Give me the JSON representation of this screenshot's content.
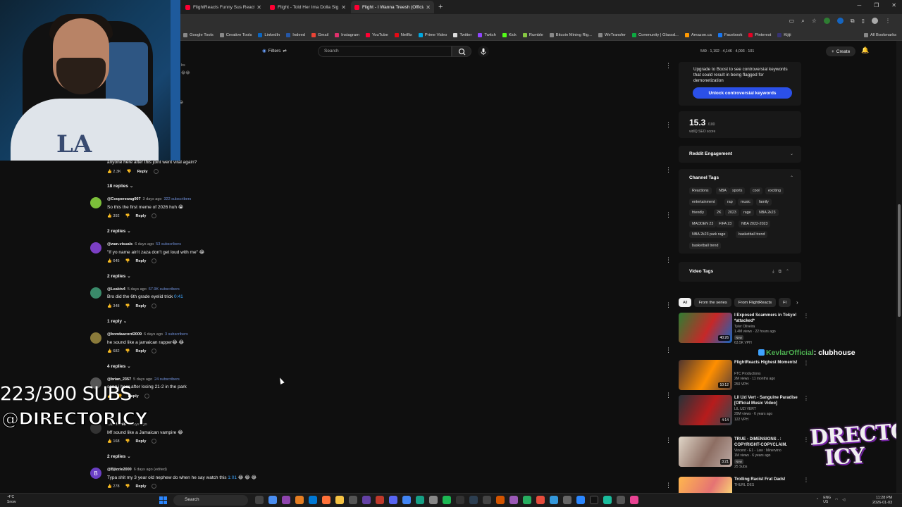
{
  "browser": {
    "tabs": [
      {
        "label": "FlightReacts Funny Sus Reactio",
        "active": false
      },
      {
        "label": "Flight - Told Her Ima Dolla Sig",
        "active": false
      },
      {
        "label": "Flight - I Wanna Treesh (Officia",
        "active": true
      }
    ],
    "bookmarks": [
      "Google Tools",
      "Creative Tools",
      "LinkedIn",
      "Indeed",
      "Gmail",
      "Instagram",
      "YouTube",
      "Netflix",
      "Prime Video",
      "Twitter",
      "Twitch",
      "Kick",
      "Rumble",
      "Bitcoin Mining Rig...",
      "WeTransfer",
      "Community | Glassd...",
      "Amazon.ca",
      "Facebook",
      "Pinterest",
      "Kijiji"
    ],
    "all_bookmarks": "All Bookmarks"
  },
  "masthead": {
    "filters_label": "Filters",
    "search_placeholder": "Search",
    "stats": "549 · 1,192 · 4,146 · 4,093 · 101",
    "create_label": "Create"
  },
  "comments": {
    "pinned_text": "anyone here after this joint went viral again?",
    "pinned_likes": "2.3K",
    "pinned_replies": "18 replies",
    "items": [
      {
        "user": "@Cooperswag007",
        "time": "3 days ago",
        "subs": "322 subscribers",
        "text": "So this the first meme of 2026 huh 😭",
        "likes": "392",
        "replies": "2 replies",
        "avatar_color": "#7cbf3a",
        "avatar_letter": ""
      },
      {
        "user": "@wan.visuals",
        "time": "6 days ago",
        "subs": "53 subscribers",
        "text": "\"If yo name ain't zaza don't get loud with me\" 😂",
        "likes": "645",
        "replies": "2 replies",
        "avatar_color": "#7b3fc4",
        "avatar_letter": ""
      },
      {
        "user": "@Leaktv4",
        "time": "5 days ago",
        "subs": "67.9K subscribers",
        "text": "Bro did the 6th grade eyelid trick",
        "timestamp": "0:41",
        "likes": "348",
        "replies": "1 reply",
        "avatar_color": "#3a8a6a",
        "avatar_letter": ""
      },
      {
        "user": "@bondaacord2009",
        "time": "6 days ago",
        "subs": "3 subscribers",
        "text": "he sound like a jamaican rapper😂 😂",
        "likes": "682",
        "replies": "4 replies",
        "avatar_color": "#8a7a3a",
        "avatar_letter": ""
      },
      {
        "user": "@brian_2357",
        "time": "5 days ago",
        "subs": "24 subscribers",
        "text": "song i hear after losing 21-2 in the park",
        "likes": "",
        "replies": "",
        "avatar_color": "#555555",
        "avatar_letter": ""
      },
      {
        "user": "...iz-demi8",
        "time": "6 days ago",
        "subs": "",
        "text": "Mf sound like a Jamaican vampire 😂",
        "likes": "168",
        "replies": "2 replies",
        "avatar_color": "#333333",
        "avatar_letter": ""
      },
      {
        "user": "@Bjizzle2000",
        "time": "6 days ago (edited)",
        "subs": "",
        "text": "Typa shit my 3 year old nephew do when he say watch this",
        "timestamp": "1:01",
        "text_suffix": "😂 😂 😂",
        "likes": "278",
        "replies": "",
        "avatar_color": "#6a3fc4",
        "avatar_letter": "B"
      }
    ],
    "reply_label": "Reply"
  },
  "overlays": {
    "subs_count": "223/300 SUBS",
    "handle": "@DIRECTORICY",
    "brand_logo": "DIRECTOR ICY",
    "chat_user": "KevlarOfficial",
    "chat_message": ": clubhouse"
  },
  "vidiq": {
    "upgrade_text": "Upgrade to Boost to see controversial keywords that could result in being flagged for demonetization",
    "unlock_label": "Unlock controversial keywords",
    "seo_score": "15.3",
    "seo_max": "/100",
    "seo_label": "vidIQ SEO score",
    "reddit_label": "Reddit Engagement",
    "channel_tags_label": "Channel Tags",
    "channel_tags": [
      "Reactions",
      "NBA",
      "sports",
      "cool",
      "exciting",
      "entertainment",
      "rap",
      "music",
      "family",
      "friendly",
      "2K",
      "2023",
      "rage",
      "NBA 2k23",
      "MADDEN 23",
      "FIFA 23",
      "NBA 2022-2023",
      "NBA 2k23 park rage",
      "basketball trend",
      "basketball trend"
    ],
    "video_tags_label": "Video Tags"
  },
  "related": {
    "chips": [
      "All",
      "From the series",
      "From FlightReacts",
      "Fl"
    ],
    "items": [
      {
        "title": "I Exposed Scammers in Tokyo! *attacked*",
        "channel": "Tyler Oliveira",
        "meta": "1.4M views · 22 hours ago",
        "badge": "New",
        "stat": "63.5K VPH",
        "duration": "40:26",
        "thumb": [
          "#2e7d32",
          "#c62828",
          "#1565c0"
        ]
      },
      {
        "title": "FlightReacts Highest Moments!",
        "channel": "FTC Productions",
        "meta": "2M views · 11 months ago",
        "badge": "",
        "stat": "250 VPH",
        "duration": "10:12",
        "thumb": [
          "#4e342e",
          "#ff8f00",
          "#5d4037"
        ]
      },
      {
        "title": "Lil Uzi Vert - Sanguine Paradise [Official Music Video]",
        "channel": "LIL UZI VERT",
        "meta": "29M views · 6 years ago",
        "badge": "",
        "stat": "122 VPH",
        "duration": "4:14",
        "thumb": [
          "#263238",
          "#b71c1c",
          "#37474f"
        ]
      },
      {
        "title": "TRUE - DIMENSIONS . : COPYRIGHT-COPYCLAIM.",
        "channel": "Vincent - E1 - Law : Minervino",
        "meta": "1M views · 6 years ago",
        "badge": "New",
        "stat": "25 Subs",
        "duration": "3:21",
        "thumb": [
          "#e0d6c8",
          "#8d6e63",
          "#bcaaa4"
        ]
      },
      {
        "title": "Trolling Racist Frat Dads!",
        "channel": "THURL DES",
        "meta": "",
        "badge": "",
        "stat": "",
        "duration": "",
        "thumb": [
          "#ffb74d",
          "#e57373",
          "#fff176"
        ]
      }
    ]
  },
  "taskbar": {
    "weather_temp": "-4°C",
    "weather_desc": "Snow",
    "search_label": "Search",
    "lang": "ENG",
    "region": "US",
    "time": "11:28 PM",
    "date": "2026-01-03"
  },
  "colors": {
    "background": "#0f0f0f",
    "accent_blue": "#3ea6ff",
    "unlock_button": "#2b50e8",
    "youtube_red": "#ff0033"
  }
}
